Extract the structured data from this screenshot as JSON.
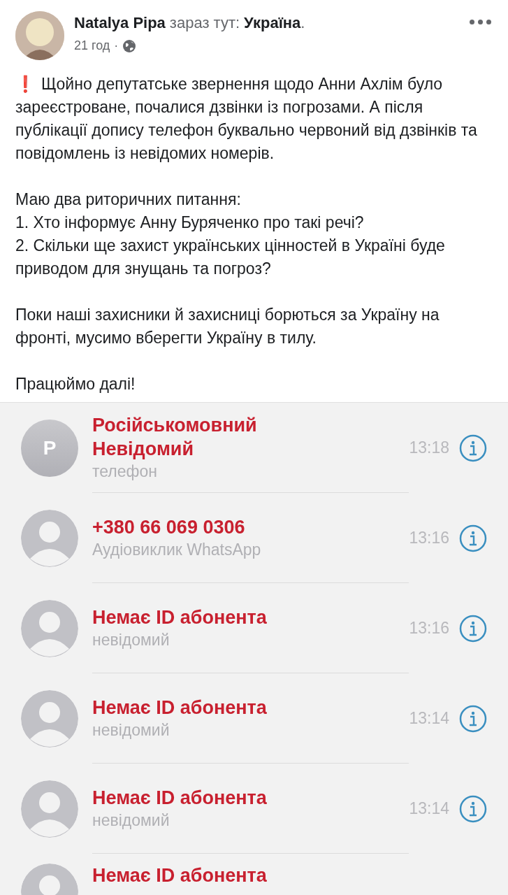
{
  "post": {
    "author": "Natalya Pipa",
    "location_prefix": "зараз тут:",
    "location": "Україна",
    "location_suffix": ".",
    "time": "21 год",
    "separator": "·",
    "alert_mark": "❗",
    "paragraphs": [
      "Щойно депутатське звернення щодо Анни Ахлім було зареєстроване, почалися дзвінки із погрозами. А після публікації допису телефон буквально червоний від дзвінків та повідомлень із невідомих номерів.",
      "Маю два риторичних питання:\n1. Хто інформує Анну Буряченко про такі речі?\n2. Скільки ще захист українських цінностей в Україні буде приводом для знущань та погроз?",
      "Поки наші захисники й захисниці борються за Україну на фронті, мусимо вберегти Україну в тилу.",
      "Працюймо далі!"
    ]
  },
  "calls": [
    {
      "avatar": {
        "kind": "letter",
        "letter": "P"
      },
      "title": "Російськомовний Невідомий",
      "subtitle": "телефон",
      "time": "13:18"
    },
    {
      "avatar": {
        "kind": "person"
      },
      "title": "+380 66 069 0306",
      "subtitle": "Аудіовиклик WhatsApp",
      "time": "13:16"
    },
    {
      "avatar": {
        "kind": "person"
      },
      "title": "Немає ID абонента",
      "subtitle": "невідомий",
      "time": "13:16"
    },
    {
      "avatar": {
        "kind": "person"
      },
      "title": "Немає ID абонента",
      "subtitle": "невідомий",
      "time": "13:14"
    },
    {
      "avatar": {
        "kind": "person"
      },
      "title": "Немає ID абонента",
      "subtitle": "невідомий",
      "time": "13:14"
    },
    {
      "avatar": {
        "kind": "person"
      },
      "title": "Немає ID абонента"
    }
  ]
}
